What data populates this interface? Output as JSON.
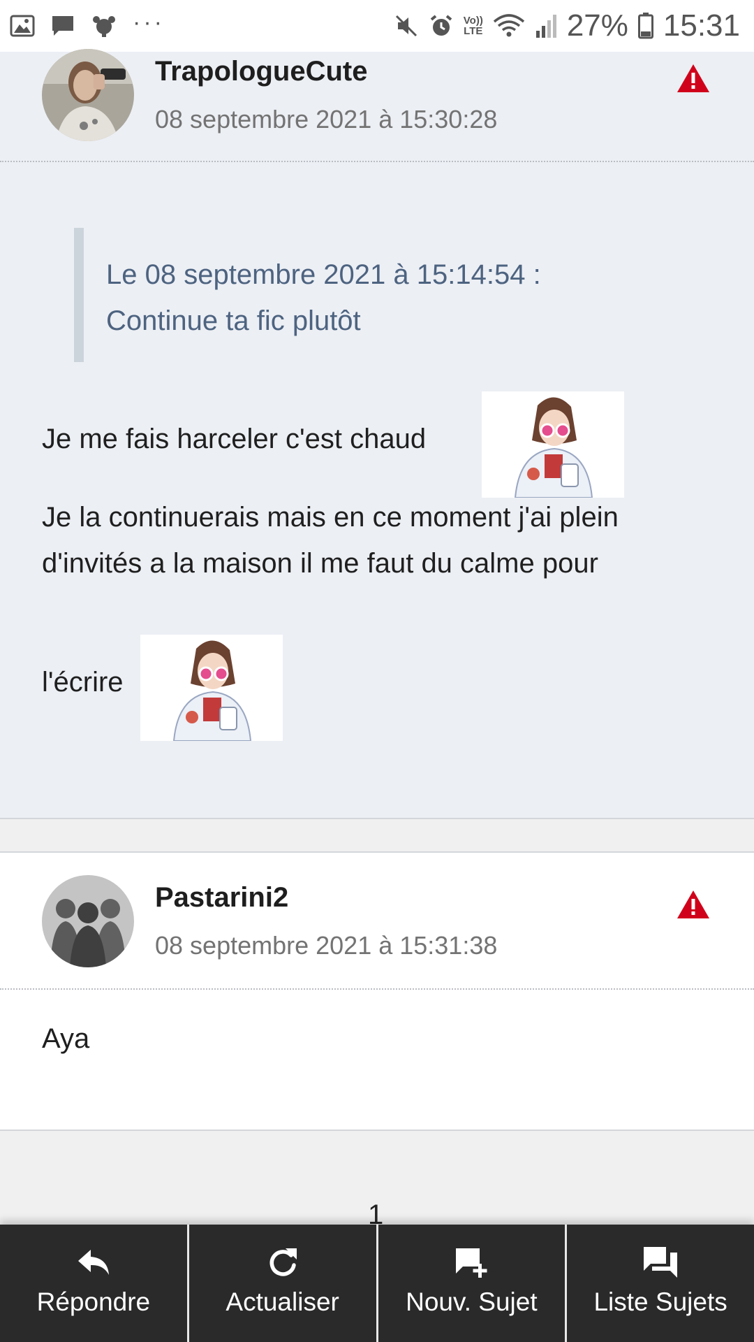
{
  "status_bar": {
    "dots": "···",
    "volte": "Vo)) LTE",
    "battery_percent": "27%",
    "time": "15:31"
  },
  "posts": [
    {
      "username": "TrapologueCute",
      "date": "08 septembre 2021 à 15:30:28",
      "quote": {
        "header": "Le 08 septembre 2021 à 15:14:54 :",
        "text": "Continue ta fic plutôt"
      },
      "lines": [
        "Je me fais harceler c'est chaud",
        "Je la continuerais mais en ce moment j'ai plein",
        "d'invités a la maison il me faut du calme pour",
        "l'écrire"
      ]
    },
    {
      "username": "Pastarini2",
      "date": "08 septembre 2021 à 15:31:38",
      "lines": [
        "Aya"
      ]
    }
  ],
  "pagination": {
    "current": "1"
  },
  "bottom_bar": {
    "items": [
      {
        "label": "Répondre",
        "icon": "reply-icon"
      },
      {
        "label": "Actualiser",
        "icon": "refresh-icon"
      },
      {
        "label": "Nouv. Sujet",
        "icon": "new-topic-icon"
      },
      {
        "label": "Liste Sujets",
        "icon": "topic-list-icon"
      }
    ]
  },
  "colors": {
    "post_bg": "#eceff4",
    "quote_text": "#4d6380",
    "report_red": "#d0021b",
    "bottom_bar": "#2a2a2a"
  }
}
